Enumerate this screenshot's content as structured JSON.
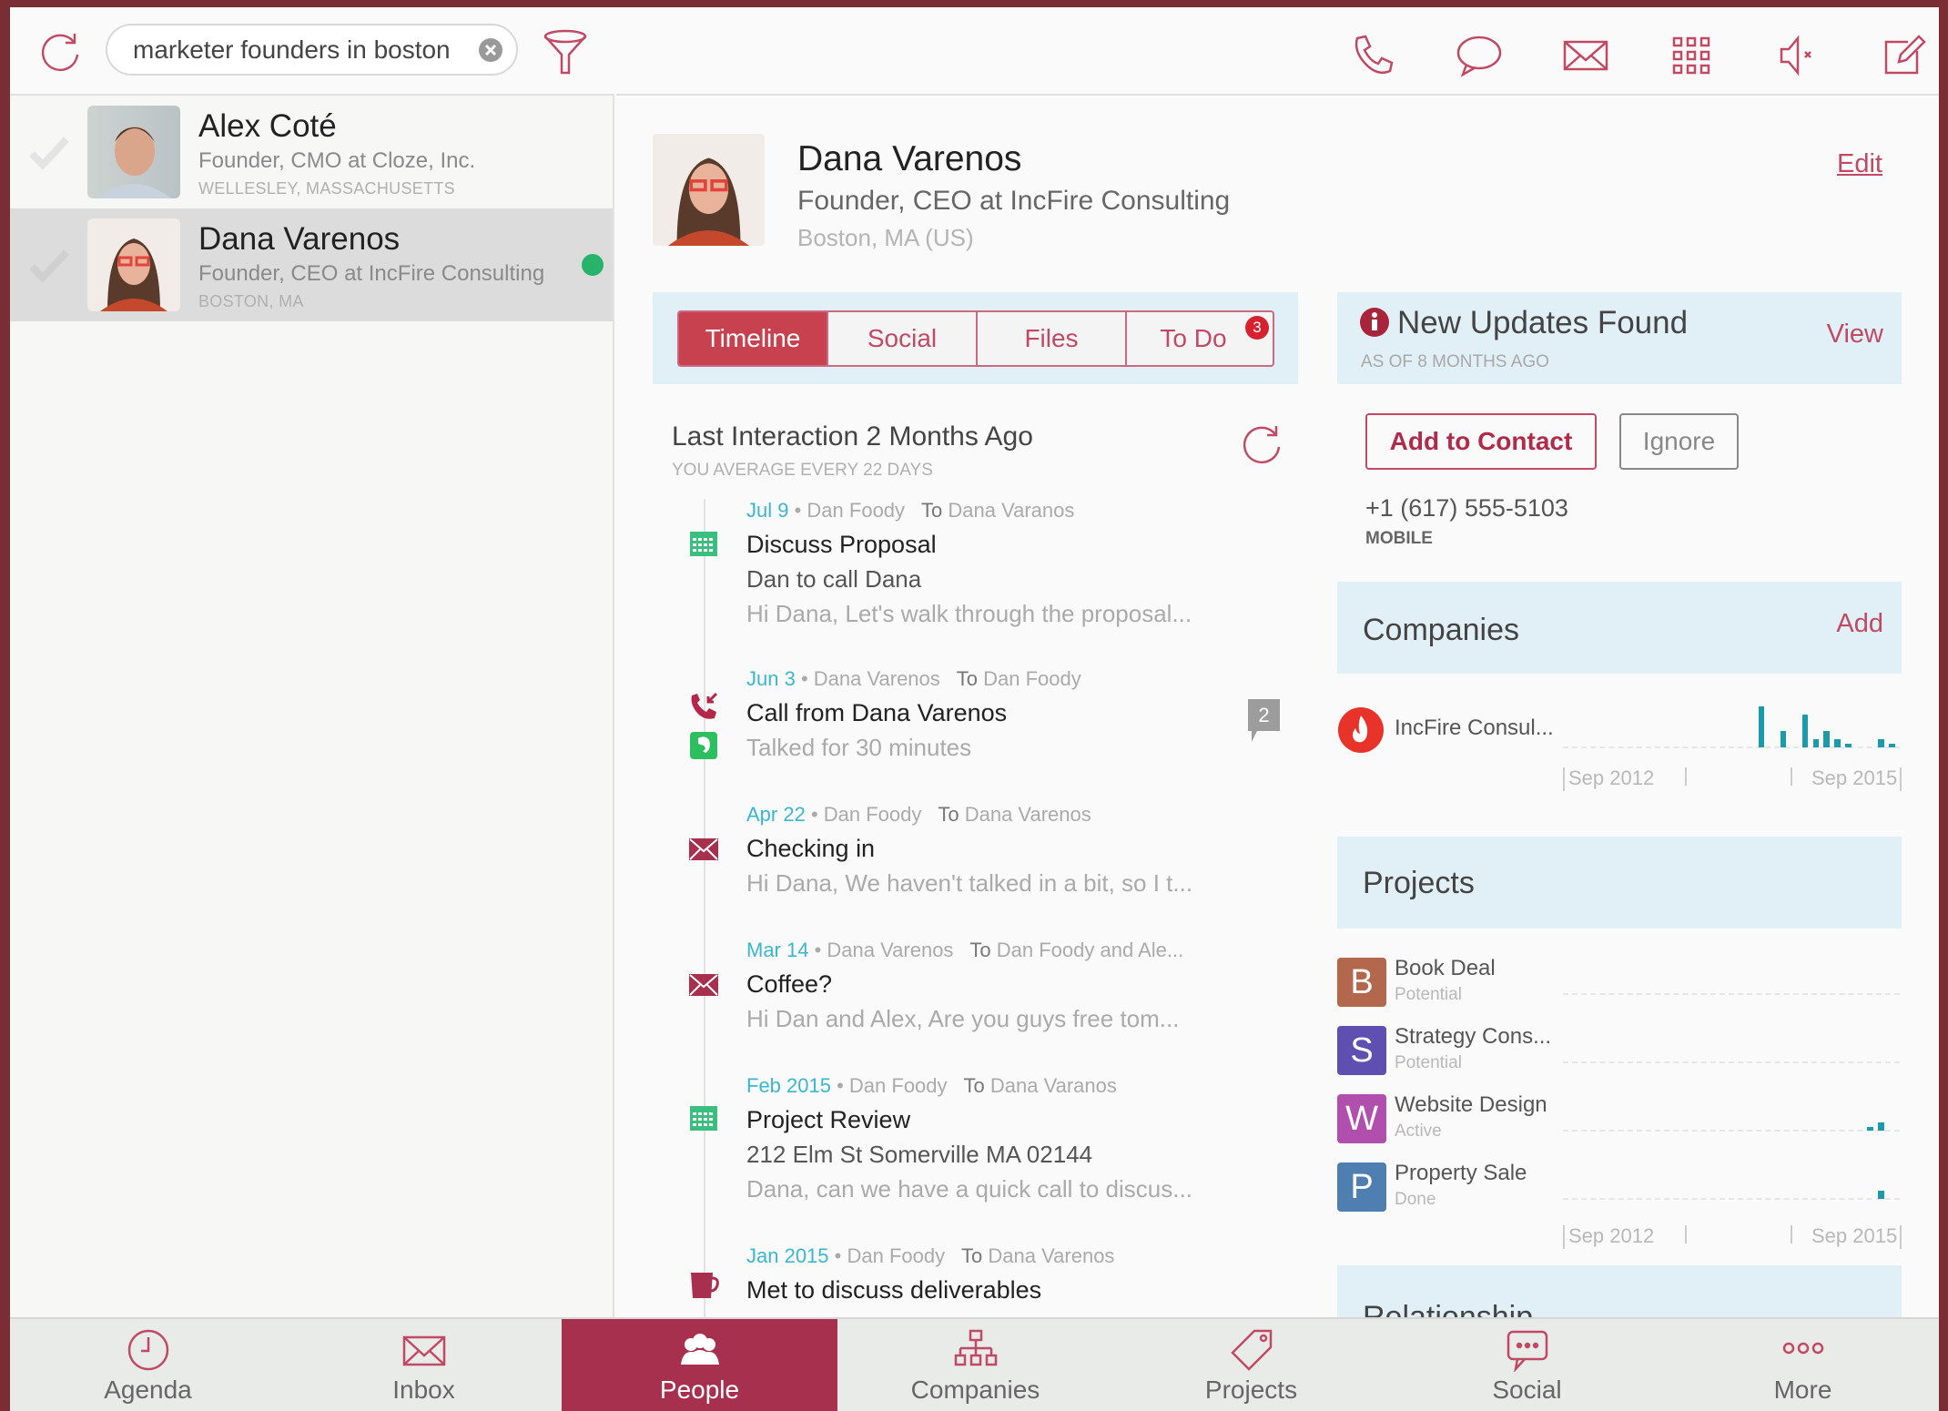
{
  "search": {
    "value": "marketer founders in boston",
    "placeholder": ""
  },
  "contacts": [
    {
      "name": "Alex Coté",
      "title": "Founder, CMO at Cloze, Inc.",
      "location": "WELLESLEY, MASSACHUSETTS",
      "selected": false,
      "online": false
    },
    {
      "name": "Dana Varenos",
      "title": "Founder, CEO at IncFire Consulting",
      "location": "BOSTON, MA",
      "selected": true,
      "online": true
    }
  ],
  "toolbar_icons": [
    "phone-icon",
    "chat-icon",
    "mail-icon",
    "grid-icon",
    "mute-icon",
    "compose-icon"
  ],
  "profile": {
    "name": "Dana Varenos",
    "title": "Founder, CEO at IncFire Consulting",
    "location": "Boston, MA (US)",
    "edit_label": "Edit"
  },
  "tabs": [
    {
      "label": "Timeline",
      "active": true
    },
    {
      "label": "Social",
      "active": false
    },
    {
      "label": "Files",
      "active": false
    },
    {
      "label": "To Do",
      "active": false,
      "badge": "3"
    }
  ],
  "interaction": {
    "title": "Last Interaction 2 Months Ago",
    "subtitle": "YOU AVERAGE EVERY 22 DAYS"
  },
  "timeline": [
    {
      "date": "Jul 9",
      "from": "Dan Foody",
      "to_label": "To",
      "to": "Dana Varanos",
      "title": "Discuss Proposal",
      "body": "Dan to call Dana",
      "snippet": "Hi Dana, Let's walk through the proposal...",
      "icon": "calendar-icon"
    },
    {
      "date": "Jun 3",
      "from": "Dana Varenos",
      "to_label": "To",
      "to": "Dan Foody",
      "title": "Call from Dana Varenos",
      "body": "",
      "snippet": "Talked for 30 minutes",
      "icon": "incoming-call-icon",
      "comments": "2"
    },
    {
      "date": "Apr 22",
      "from": "Dan Foody",
      "to_label": "To",
      "to": "Dana Varenos",
      "title": "Checking in",
      "body": "",
      "snippet": "Hi Dana, We haven't talked in a bit, so I t...",
      "icon": "mail-icon"
    },
    {
      "date": "Mar 14",
      "from": "Dana Varenos",
      "to_label": "To",
      "to": "Dan Foody and Ale...",
      "title": "Coffee?",
      "body": "",
      "snippet": "Hi Dan and Alex, Are you guys free tom...",
      "icon": "mail-icon"
    },
    {
      "date": "Feb 2015",
      "from": "Dan Foody",
      "to_label": "To",
      "to": "Dana Varanos",
      "title": "Project Review",
      "body": "212 Elm St Somerville MA 02144",
      "snippet": "Dana, can we have a quick call to discus...",
      "icon": "calendar-icon"
    },
    {
      "date": "Jan 2015",
      "from": "Dan Foody",
      "to_label": "To",
      "to": "Dana Varenos",
      "title": "Met to discuss deliverables",
      "body": "",
      "snippet": "",
      "icon": "mug-icon"
    }
  ],
  "updates": {
    "title": "New Updates Found",
    "subtitle": "AS OF 8 MONTHS AGO",
    "view_label": "View",
    "add_label": "Add to Contact",
    "ignore_label": "Ignore",
    "phone": "+1 (617) 555-5103",
    "phone_type": "MOBILE"
  },
  "companies": {
    "title": "Companies",
    "add_label": "Add",
    "items": [
      {
        "name": "IncFire Consul...",
        "activity": [
          0,
          0,
          0,
          0,
          0,
          0,
          0,
          0,
          0,
          0,
          0,
          0,
          0,
          0,
          0,
          0,
          0,
          0,
          10,
          0,
          4,
          0,
          8,
          2,
          4,
          2,
          1,
          0,
          0,
          2,
          1
        ]
      }
    ],
    "axis_start": "Sep 2012",
    "axis_end": "Sep 2015"
  },
  "projects": {
    "title": "Projects",
    "items": [
      {
        "letter": "B",
        "name": "Book Deal",
        "status": "Potential",
        "color": "#b3674d",
        "activity": []
      },
      {
        "letter": "S",
        "name": "Strategy Cons...",
        "status": "Potential",
        "color": "#5e4fb0",
        "activity": []
      },
      {
        "letter": "W",
        "name": "Website Design",
        "status": "Active",
        "color": "#b04fae",
        "activity": [
          0,
          0,
          0,
          0,
          0,
          0,
          0,
          0,
          0,
          0,
          0,
          0,
          0,
          0,
          0,
          0,
          0,
          0,
          0,
          0,
          0,
          0,
          0,
          0,
          0,
          0,
          0,
          0,
          1,
          2,
          0
        ]
      },
      {
        "letter": "P",
        "name": "Property Sale",
        "status": "Done",
        "color": "#4f7fb0",
        "activity": [
          0,
          0,
          0,
          0,
          0,
          0,
          0,
          0,
          0,
          0,
          0,
          0,
          0,
          0,
          0,
          0,
          0,
          0,
          0,
          0,
          0,
          0,
          0,
          0,
          0,
          0,
          0,
          0,
          0,
          2,
          0
        ]
      }
    ],
    "axis_start": "Sep 2012",
    "axis_end": "Sep 2015"
  },
  "relationship": {
    "title": "Relationship"
  },
  "bottom_nav": [
    {
      "label": "Agenda",
      "icon": "clock-icon",
      "active": false
    },
    {
      "label": "Inbox",
      "icon": "inbox-icon",
      "active": false
    },
    {
      "label": "People",
      "icon": "people-icon",
      "active": true
    },
    {
      "label": "Companies",
      "icon": "org-chart-icon",
      "active": false
    },
    {
      "label": "Projects",
      "icon": "tag-icon",
      "active": false
    },
    {
      "label": "Social",
      "icon": "social-chat-icon",
      "active": false
    },
    {
      "label": "More",
      "icon": "more-icon",
      "active": false
    }
  ],
  "colors": {
    "brand": "#a8304f",
    "accent_link": "#c04a64",
    "date": "#3bb6cf",
    "spark": "#1d9aa8",
    "panel": "#e1f0f6",
    "frame": "#7a2e34"
  }
}
